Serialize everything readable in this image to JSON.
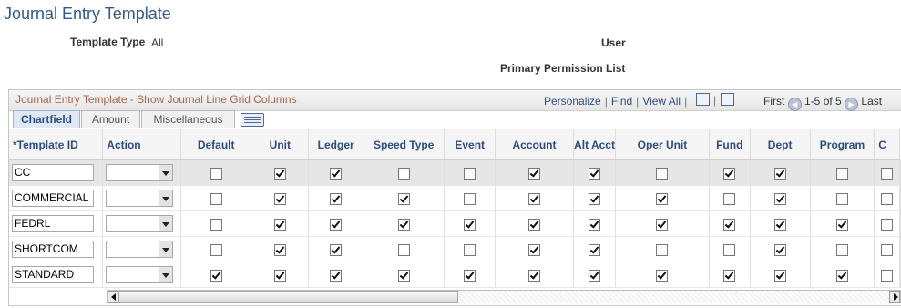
{
  "page": {
    "title": "Journal Entry Template"
  },
  "fields": {
    "template_type_label": "Template Type",
    "template_type_value": "All",
    "user_label": "User",
    "primary_permission_label": "Primary Permission List"
  },
  "grid": {
    "title": "Journal Entry Template - Show Journal Line Grid Columns",
    "personalize": "Personalize",
    "find": "Find",
    "view_all": "View All",
    "first": "First",
    "range": "1-5 of 5",
    "last": "Last",
    "tabs": [
      "Chartfield",
      "Amount",
      "Miscellaneous"
    ],
    "columns": [
      "*Template ID",
      "Action",
      "Default",
      "Unit",
      "Ledger",
      "Speed Type",
      "Event",
      "Account",
      "Alt Acct",
      "Oper Unit",
      "Fund",
      "Dept",
      "Program",
      "C"
    ],
    "rows": [
      {
        "id": "CC",
        "checks": [
          false,
          true,
          true,
          false,
          false,
          true,
          true,
          false,
          true,
          true,
          false,
          false
        ]
      },
      {
        "id": "COMMERCIAL",
        "checks": [
          false,
          true,
          true,
          true,
          false,
          true,
          true,
          true,
          false,
          true,
          false,
          false
        ]
      },
      {
        "id": "FEDRL",
        "checks": [
          false,
          true,
          true,
          true,
          true,
          true,
          true,
          true,
          true,
          true,
          true,
          false
        ]
      },
      {
        "id": "SHORTCOM",
        "checks": [
          false,
          true,
          true,
          false,
          false,
          true,
          true,
          false,
          false,
          true,
          false,
          false
        ]
      },
      {
        "id": "STANDARD",
        "checks": [
          true,
          true,
          true,
          true,
          true,
          true,
          true,
          true,
          true,
          true,
          true,
          false
        ]
      }
    ]
  }
}
